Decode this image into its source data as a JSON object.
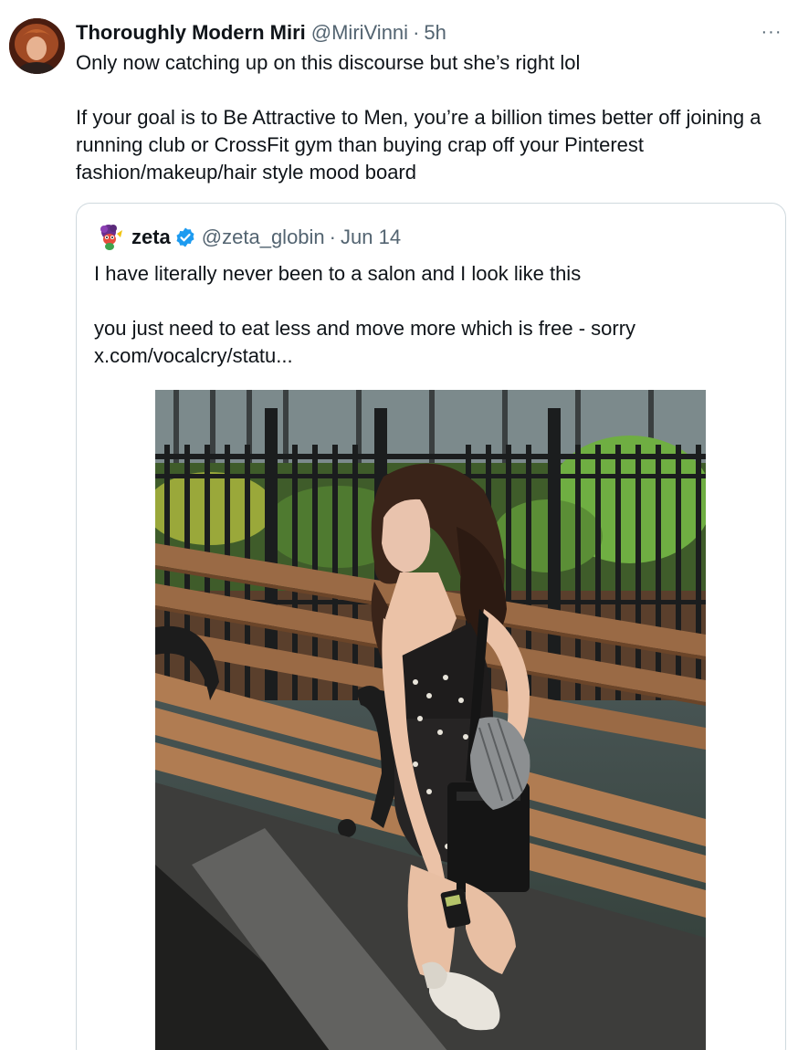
{
  "tweet": {
    "author": {
      "display_name": "Thoroughly Modern Miri",
      "handle": "@MiriVinni",
      "separator": "·",
      "time": "5h"
    },
    "more_label": "···",
    "text": "Only now catching up on this discourse but she’s right lol\n\nIf your goal is to Be Attractive to Men, you’re a billion times better off joining a running club or CrossFit gym than buying crap off your Pinterest fashion/makeup/hair style mood board"
  },
  "quote": {
    "author": {
      "display_name": "zeta",
      "verified": true,
      "handle": "@zeta_globin",
      "separator": "·",
      "time": "Jun 14"
    },
    "text": "I have literally never been to a salon and I look like this\n\nyou just need to eat less and move more which is free - sorry\nx.com/vocalcry/statu..."
  },
  "colors": {
    "text_primary": "#0f1419",
    "text_secondary": "#536471",
    "border": "#cfd9de",
    "verified_blue": "#1d9bf0"
  },
  "icons": {
    "more": "more-horizontal-icon",
    "verified": "verified-badge-icon"
  }
}
